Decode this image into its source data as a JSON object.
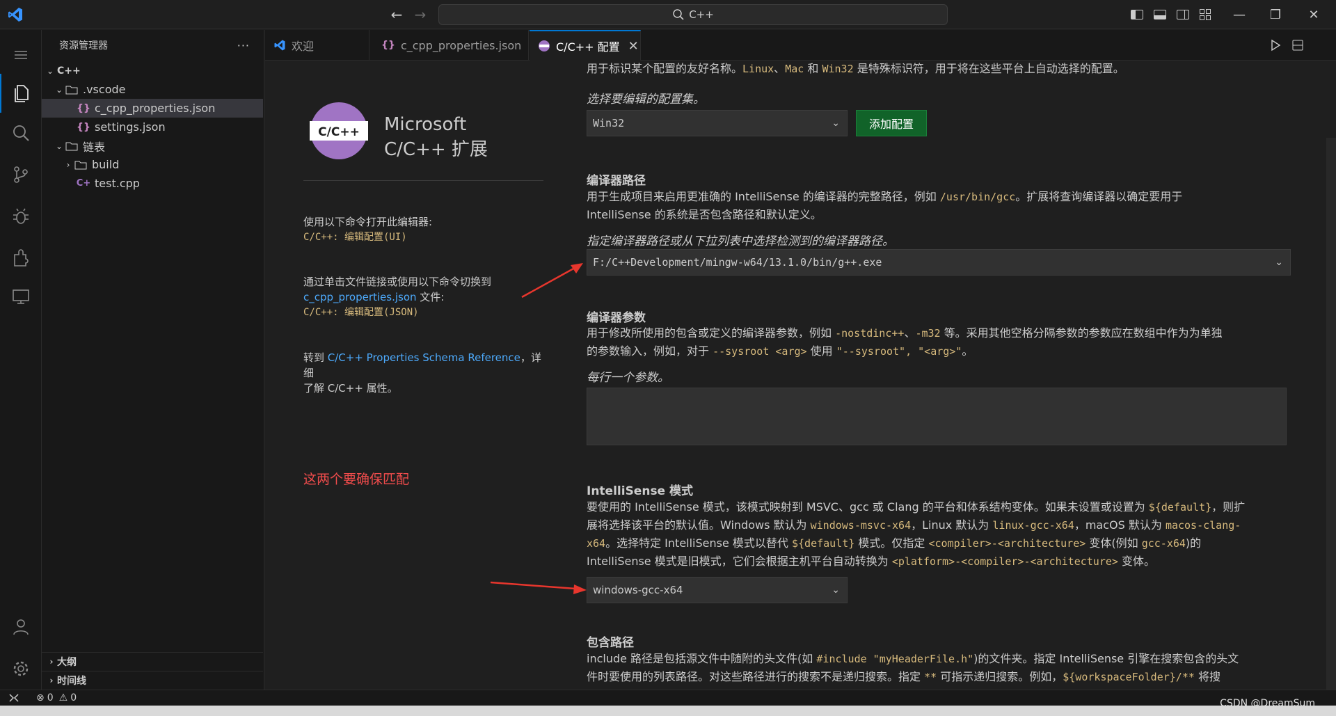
{
  "titlebar": {
    "search_text": "C++",
    "icons": [
      "vscode-logo-icon",
      "arrow-left-icon",
      "arrow-right-icon",
      "search-icon",
      "toggle-primary-sidebar-icon",
      "toggle-panel-icon",
      "toggle-secondary-sidebar-icon",
      "customize-layout-icon",
      "minimize-icon",
      "restore-icon",
      "close-icon"
    ]
  },
  "activitybar": {
    "items": [
      "explorer-icon",
      "search-icon",
      "source-control-icon",
      "run-debug-icon",
      "extensions-icon",
      "remote-explorer-icon",
      "accounts-icon",
      "settings-gear-icon"
    ]
  },
  "sidebar": {
    "title": "资源管理器",
    "more": "···",
    "tree": [
      {
        "label": "C++",
        "depth": 0,
        "kind": "folder-root"
      },
      {
        "label": ".vscode",
        "depth": 1,
        "kind": "folder"
      },
      {
        "label": "c_cpp_properties.json",
        "depth": 2,
        "kind": "json"
      },
      {
        "label": "settings.json",
        "depth": 2,
        "kind": "json"
      },
      {
        "label": "链表",
        "depth": 1,
        "kind": "folder"
      },
      {
        "label": "build",
        "depth": 2,
        "kind": "folder-collapsed"
      },
      {
        "label": "test.cpp",
        "depth": 2,
        "kind": "cpp"
      }
    ],
    "outline": "大纲",
    "timeline": "时间线"
  },
  "tabs": [
    {
      "label": "欢迎",
      "icon": "vscode-icon"
    },
    {
      "label": "c_cpp_properties.json",
      "icon": "json-icon"
    },
    {
      "label": "C/C++ 配置",
      "icon": "cpp-extension-icon",
      "active": true
    }
  ],
  "editor_actions": [
    "run-icon",
    "split-editor-icon"
  ],
  "config": {
    "ext_title_line1": "Microsoft",
    "ext_title_line2": "C/C++ 扩展",
    "logo_text": "C/C++",
    "open_ui_text": "使用以下命令打开此编辑器:",
    "open_ui_cmd": "C/C++: 编辑配置(UI)",
    "switch_text_1": "通过单击文件链接或使用以下命令切换到",
    "switch_link": "c_cpp_properties.json",
    "switch_text_2": " 文件:",
    "switch_cmd": "C/C++: 编辑配置(JSON)",
    "goto_text": "转到 ",
    "goto_link": "C/C++ Properties Schema Reference",
    "goto_text_2": "，详细",
    "goto_text_3": "了解 C/C++ 属性。",
    "note": "这两个要确保匹配",
    "name_desc_1": "用于标识某个配置的友好名称。",
    "name_desc_code1": "Linux",
    "name_desc_sep1": "、",
    "name_desc_code2": "Mac",
    "name_desc_and": " 和 ",
    "name_desc_code3": "Win32",
    "name_desc_2": " 是特殊标识符，用于将在这些平台上自动选择的配置。",
    "select_config_hint": "选择要编辑的配置集。",
    "config_select": "Win32",
    "add_config": "添加配置",
    "compiler_path_title": "编译器路径",
    "compiler_path_desc_1": "用于生成项目来启用更准确的 IntelliSense 的编译器的完整路径，例如 ",
    "compiler_path_code": "/usr/bin/gcc",
    "compiler_path_desc_2": "。扩展将查询编译器以确定要用于",
    "compiler_path_desc_3": "IntelliSense 的系统是否包含路径和默认定义。",
    "compiler_path_hint": "指定编译器路径或从下拉列表中选择检测到的编译器路径。",
    "compiler_path_value": "F:/C++Development/mingw-w64/13.1.0/bin/g++.exe",
    "compiler_args_title": "编译器参数",
    "compiler_args_desc_1": "用于修改所使用的包含或定义的编译器参数，例如 ",
    "compiler_args_code1": "-nostdinc++",
    "compiler_args_sep": "、",
    "compiler_args_code2": "-m32",
    "compiler_args_desc_2": " 等。采用其他空格分隔参数的参数应在数组中作为为单独",
    "compiler_args_desc_3": "的参数输入，例如，对于 ",
    "compiler_args_code3": "--sysroot <arg>",
    "compiler_args_desc_4": " 使用 ",
    "compiler_args_code4": "\"--sysroot\", \"<arg>\"",
    "compiler_args_desc_5": "。",
    "compiler_args_hint": "每行一个参数。",
    "is_title": "IntelliSense 模式",
    "is_desc_1": "要使用的 IntelliSense 模式，该模式映射到 MSVC、gcc 或 Clang 的平台和体系结构变体。如果未设置或设置为 ",
    "is_code_default": "${default}",
    "is_desc_2": "，则扩",
    "is_desc_3": "展将选择该平台的默认值。Windows 默认为 ",
    "is_code_win": "windows-msvc-x64",
    "is_desc_4": "，Linux 默认为 ",
    "is_code_linux": "linux-gcc-x64",
    "is_desc_5": "，macOS 默认为 ",
    "is_code_mac1": "macos-clang-",
    "is_code_mac2": "x64",
    "is_desc_6": "。选择特定 IntelliSense 模式以替代 ",
    "is_desc_7": " 模式。仅指定 ",
    "is_code_ca": "<compiler>-<architecture>",
    "is_desc_8": " 变体(例如 ",
    "is_code_gcc": "gcc-x64",
    "is_desc_9": ")的",
    "is_desc_10": "IntelliSense 模式是旧模式，它们会根据主机平台自动转换为 ",
    "is_code_pca": "<platform>-<compiler>-<architecture>",
    "is_desc_11": " 变体。",
    "is_value": "windows-gcc-x64",
    "include_title": "包含路径",
    "include_desc_1": "include 路径是包括源文件中随附的头文件(如 ",
    "include_code1": "#include \"myHeaderFile.h\"",
    "include_desc_2": ")的文件夹。指定 IntelliSense 引擎在搜索包含的头文",
    "include_desc_3": "件时要使用的列表路径。对这些路径进行的搜索不是递归搜索。指定 ",
    "include_code2": "**",
    "include_desc_4": " 可指示递归搜索。例如，",
    "include_code3": "${workspaceFolder}/**",
    "include_desc_5": " 将搜"
  },
  "statusbar": {
    "errors": "0",
    "warnings": "0",
    "watermark": "CSDN @DreamSum"
  },
  "colors": {
    "accent": "#0078d4",
    "code": "#d7ba7d",
    "link": "#4daafc",
    "note": "#f14c4c",
    "button": "#116329"
  }
}
